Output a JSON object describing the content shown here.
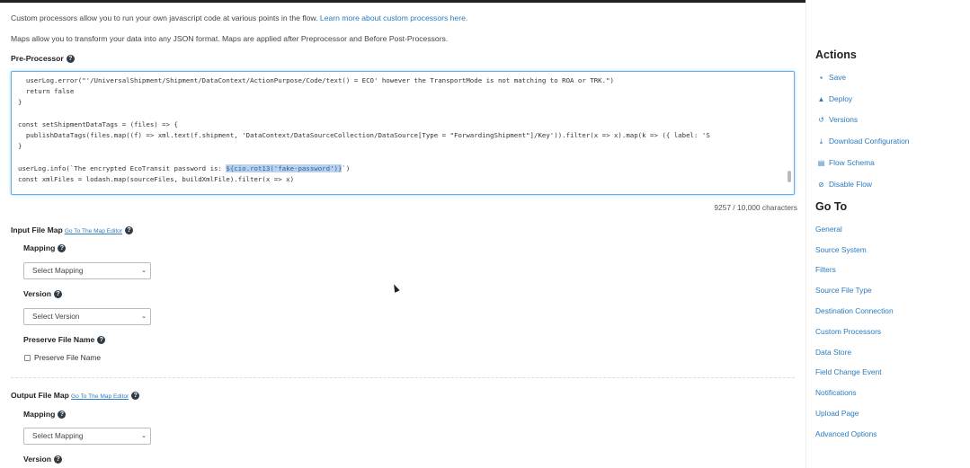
{
  "intro": {
    "line1_text": "Custom processors allow you to run your own javascript code at various points in the flow.",
    "line1_link": "Learn more about custom processors here.",
    "line2_text": "Maps allow you to transform your data into any JSON format. Maps are applied after Preprocessor and Before Post-Processors."
  },
  "preprocessor": {
    "label": "Pre-Processor",
    "code_lines": [
      "  userLog.error(\"'/UniversalShipment/Shipment/DataContext/ActionPurpose/Code/text() = ECO' however the TransportMode is not matching to ROA or TRK.\")",
      "  return false",
      "}",
      "",
      "const setShipmentDataTags = (files) => {",
      "  publishDataTags(files.map((f) => xml.text(f.shipment, 'DataContext/DataSourceCollection/DataSource[Type = \"ForwardingShipment\"]/Key')).filter(x => x).map(k => ({ label: 'S",
      "}",
      "",
      "userLog.info(`The encrypted EcoTransit password is: ",
      "const xmlFiles = lodash.map(sourceFiles, buildXmlFile).filter(x => x)"
    ],
    "highlight": "${cio.rot13('fake-password')}",
    "line9_tail": "`)",
    "char_count": "9257 / 10,000 characters"
  },
  "input_map": {
    "label": "Input File Map",
    "goto_link": "Go To The Map Editor",
    "mapping_label": "Mapping",
    "mapping_value": "Select Mapping",
    "version_label": "Version",
    "version_value": "Select Version",
    "preserve_label": "Preserve File Name",
    "preserve_checkbox_label": "Preserve File Name"
  },
  "output_map": {
    "label": "Output File Map",
    "goto_link": "Go To The Map Editor",
    "mapping_label": "Mapping",
    "mapping_value": "Select Mapping",
    "version_label": "Version"
  },
  "sidebar": {
    "actions_title": "Actions",
    "actions": [
      {
        "label": "Save",
        "icon": "save-icon",
        "glyph": "▪"
      },
      {
        "label": "Deploy",
        "icon": "warning-icon",
        "glyph": "▲"
      },
      {
        "label": "Versions",
        "icon": "history-icon",
        "glyph": "↺"
      },
      {
        "label": "Download Configuration",
        "icon": "download-icon",
        "glyph": "⤓"
      },
      {
        "label": "Flow Schema",
        "icon": "file-icon",
        "glyph": "▤"
      },
      {
        "label": "Disable Flow",
        "icon": "disable-icon",
        "glyph": "⊘"
      }
    ],
    "goto_title": "Go To",
    "goto": [
      "General",
      "Source System",
      "Filters",
      "Source File Type",
      "Destination Connection",
      "Custom Processors",
      "Data Store",
      "Field Change Event",
      "Notifications",
      "Upload Page",
      "Advanced Options"
    ]
  },
  "colors": {
    "link": "#2a7bbf",
    "focus_border": "#66afe9",
    "highlight": "#b9d3ee"
  }
}
